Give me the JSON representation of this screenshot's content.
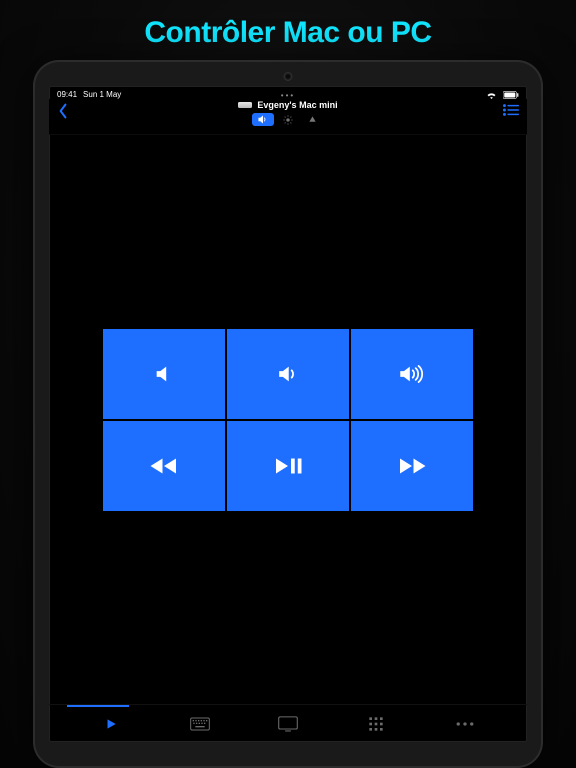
{
  "headline": "Contrôler Mac ou PC",
  "status": {
    "time": "09:41",
    "date": "Sun 1 May"
  },
  "header": {
    "device_label": "Evgeny's Mac mini"
  },
  "segments": [
    "volume",
    "brightness",
    "arrows"
  ],
  "grid": {
    "mute": "mute",
    "vol_down": "volume down",
    "vol_up": "volume up",
    "rewind": "rewind",
    "playpause": "play/pause",
    "forward": "forward"
  },
  "tabs": [
    "play",
    "keyboard",
    "screen",
    "grid",
    "more"
  ],
  "colors": {
    "accent": "#1E6EFF",
    "headline": "#11e6ff"
  }
}
